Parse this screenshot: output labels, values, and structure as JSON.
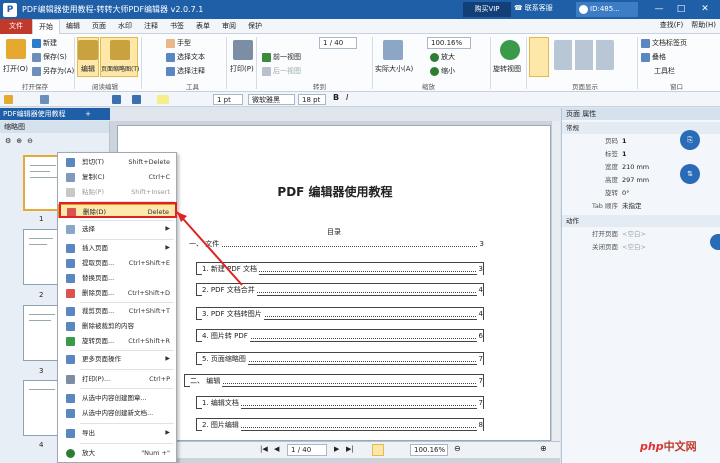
{
  "titlebar": {
    "logo": "P",
    "title": "PDF编辑器使用教程-转转大师PDF编辑器 v2.0.7.1",
    "vip_label": "购买VIP",
    "support_label": "联系客服",
    "user_id": "ID:485...",
    "buttons": [
      "—",
      "□",
      "✕"
    ]
  },
  "menubar": {
    "file": "文件",
    "tabs": [
      "开始",
      "编辑",
      "页面",
      "水印",
      "注释",
      "书签",
      "表单",
      "审阅",
      "保护"
    ],
    "active_tab": "开始",
    "right": [
      "查找(F)",
      "帮助(H)"
    ]
  },
  "ribbon": {
    "file_group": {
      "open": "打开(O)",
      "new": "新建",
      "save": "保存(S)",
      "save_as": "另存为(A)",
      "label": "打开保存"
    },
    "read_group": {
      "edit": "编辑",
      "thumbnail": "页面缩略图(T)",
      "label": "阅读编辑"
    },
    "tools_group": {
      "hand": "手型",
      "select_text": "选择文本",
      "select_comment": "选择注释",
      "label": "工具"
    },
    "print": "打印(P)",
    "nav_group": {
      "page_value": "1",
      "page_total": "/ 40",
      "prev_view": "前一视图",
      "next_view": "后一视图",
      "label": "转到"
    },
    "zoom_group": {
      "actual_size": "实际大小(A)",
      "zoom_value": "100.16%",
      "zoom_in": "放大",
      "zoom_out": "缩小",
      "label": "缩放"
    },
    "rotate": "旋转视图",
    "display_label": "页面显示",
    "window_group": {
      "doc_tabs": "文档标签页",
      "layout": "叠格",
      "tools": "工具栏",
      "label": "窗口"
    }
  },
  "toolbar2": {
    "font_size": "1 pt",
    "font_name": "微软雅黑",
    "font_pt": "18 pt"
  },
  "tabs": {
    "doc_tab": "PDF编辑器使用教程",
    "add": "+"
  },
  "left_panel": {
    "title": "缩略图",
    "pages": [
      "1",
      "2",
      "3",
      "4"
    ]
  },
  "context_menu": {
    "items": [
      {
        "label": "剪切(T)",
        "shortcut": "Shift+Delete"
      },
      {
        "label": "复制(C)",
        "shortcut": "Ctrl+C"
      },
      {
        "label": "粘贴(P)",
        "shortcut": "Shift+Insert"
      },
      {
        "label": "删除(D)",
        "shortcut": "Delete"
      },
      {
        "label": "选择",
        "shortcut": ""
      },
      {
        "label": "插入页面",
        "shortcut": ""
      },
      {
        "label": "提取页面...",
        "shortcut": "Ctrl+Shift+E"
      },
      {
        "label": "替换页面...",
        "shortcut": ""
      },
      {
        "label": "删除页面...",
        "shortcut": "Ctrl+Shift+D"
      },
      {
        "label": "裁剪页面...",
        "shortcut": "Ctrl+Shift+T"
      },
      {
        "label": "删除被裁剪的内容",
        "shortcut": ""
      },
      {
        "label": "旋转页面...",
        "shortcut": "Ctrl+Shift+R"
      },
      {
        "label": "更多页面操作",
        "shortcut": ""
      },
      {
        "label": "打印(P)...",
        "shortcut": "Ctrl+P"
      },
      {
        "label": "从选中内容创建图章...",
        "shortcut": ""
      },
      {
        "label": "从选中内容创建新文档...",
        "shortcut": ""
      },
      {
        "label": "导出",
        "shortcut": ""
      },
      {
        "label": "放大",
        "shortcut": "\"Num +\""
      }
    ]
  },
  "document": {
    "title": "PDF 编辑器使用教程",
    "toc_heading": "目录",
    "entries": [
      {
        "label": "一、 文件",
        "page": "3"
      },
      {
        "label": "1. 新建 PDF 文档",
        "page": "3"
      },
      {
        "label": "2. PDF 文档合并",
        "page": "4"
      },
      {
        "label": "3. PDF 文档转图片",
        "page": "4"
      },
      {
        "label": "4. 图片转 PDF",
        "page": "6"
      },
      {
        "label": "5. 页面缩略图",
        "page": "7"
      },
      {
        "label": "二、 编辑",
        "page": "7"
      },
      {
        "label": "1. 编辑文档",
        "page": "7"
      },
      {
        "label": "2. 图片编辑",
        "page": "8"
      }
    ]
  },
  "status": {
    "page_value": "1",
    "page_total": "/ 40",
    "zoom": "100.16%"
  },
  "right_panel": {
    "title": "页面 属性",
    "section_general": "常规",
    "page_label_k": "页码",
    "page_label_v": "1",
    "tag_k": "标签",
    "tag_v": "1",
    "width_k": "宽度",
    "width_v": "210 mm",
    "height_k": "高度",
    "height_v": "297 mm",
    "rotate_k": "旋转",
    "rotate_v": "0°",
    "tab_order_k": "Tab 顺序",
    "tab_order_v": "未指定",
    "section_action": "动作",
    "open_page_k": "打开页面",
    "open_page_v": "<空白>",
    "close_page_k": "关闭页面",
    "close_page_v": "<空白>"
  },
  "watermark": {
    "prefix": "php",
    "suffix": "中文网"
  }
}
